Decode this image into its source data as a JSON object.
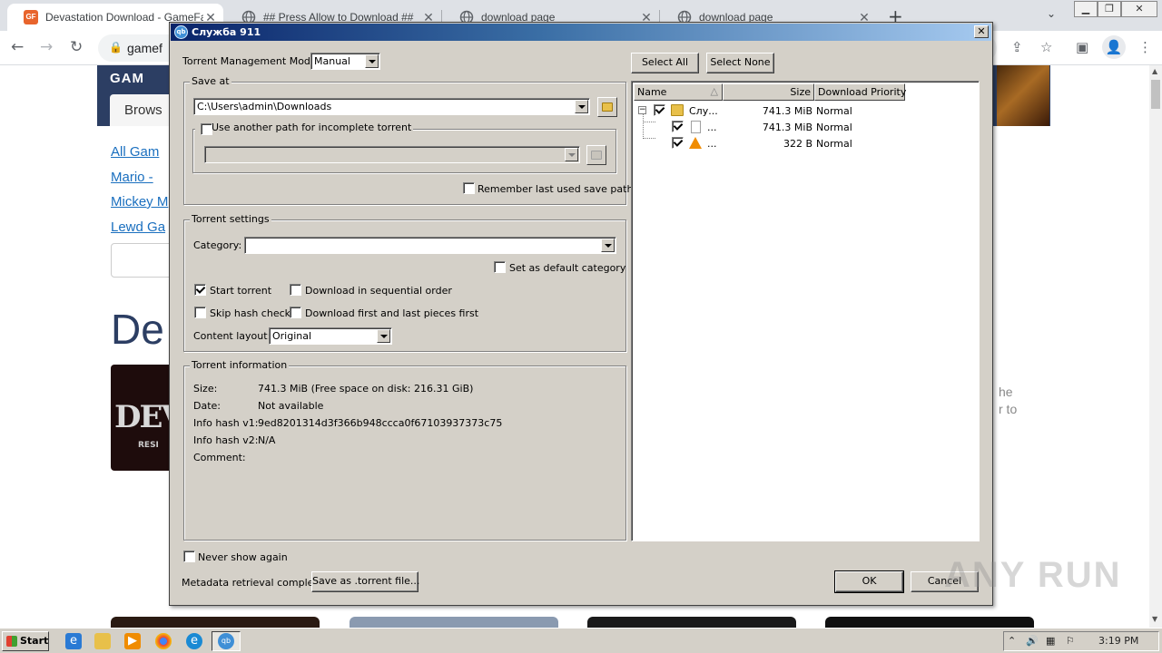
{
  "browser": {
    "tabs": [
      {
        "title": "Devastation Download - GameFabric",
        "active": true,
        "icon": "gamefabric-icon"
      },
      {
        "title": "## Press Allow to Download ##",
        "active": false,
        "icon": "globe-icon"
      },
      {
        "title": "download page",
        "active": false,
        "icon": "globe-icon"
      },
      {
        "title": "download page",
        "active": false,
        "icon": "globe-icon"
      }
    ],
    "url": "gamef",
    "tab_close": "✕",
    "new_tab": "+"
  },
  "website": {
    "logo": "GAM",
    "browse": "Brows",
    "links": [
      "All Gam",
      "Mario - ",
      "Mickey M",
      "Lewd Ga"
    ],
    "title": "De",
    "game_image_text": "DEV",
    "game_image_sub": "RESI",
    "right_text_1": "he",
    "right_text_2": "r to"
  },
  "dialog": {
    "title": "Служба 911",
    "tmm_label": "Torrent Management Mode:",
    "tmm_value": "Manual",
    "save_at_group": "Save at",
    "save_path": "C:\\Users\\admin\\Downloads",
    "use_another_path": "Use another path for incomplete torrent",
    "remember_path": "Remember last used save path",
    "torrent_settings_group": "Torrent settings",
    "category_label": "Category:",
    "category_value": "",
    "set_default_category": "Set as default category",
    "start_torrent": "Start torrent",
    "sequential": "Download in sequential order",
    "skip_hash": "Skip hash check",
    "first_last": "Download first and last pieces first",
    "content_layout_label": "Content layout:",
    "content_layout_value": "Original",
    "torrent_info_group": "Torrent information",
    "info": {
      "size_label": "Size:",
      "size_value": "741.3 MiB (Free space on disk: 216.31 GiB)",
      "date_label": "Date:",
      "date_value": "Not available",
      "hash1_label": "Info hash v1:",
      "hash1_value": "9ed8201314d3f366b948ccca0f67103937373c75",
      "hash2_label": "Info hash v2:",
      "hash2_value": "N/A",
      "comment_label": "Comment:",
      "comment_value": ""
    },
    "never_show": "Never show again",
    "metadata_status": "Metadata retrieval complete",
    "save_torrent_button": "Save as .torrent file...",
    "select_all": "Select All",
    "select_none": "Select None",
    "columns": {
      "name": "Name",
      "size": "Size",
      "priority": "Download Priority"
    },
    "files": [
      {
        "name": "Слу...",
        "size": "741.3 MiB",
        "priority": "Normal",
        "type": "folder"
      },
      {
        "name": "...",
        "size": "741.3 MiB",
        "priority": "Normal",
        "type": "file"
      },
      {
        "name": "...",
        "size": "322 B",
        "priority": "Normal",
        "type": "vlc"
      }
    ],
    "ok": "OK",
    "cancel": "Cancel",
    "close": "✕"
  },
  "taskbar": {
    "start": "Start",
    "clock": "3:19 PM"
  },
  "watermark": "ANY RUN"
}
